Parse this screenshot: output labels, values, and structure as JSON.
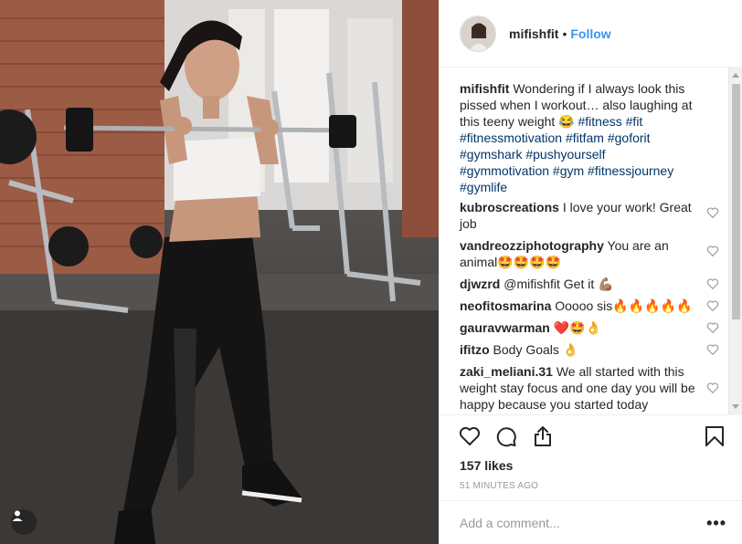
{
  "post": {
    "username": "mifishfit",
    "follow_label": "Follow",
    "caption_text": "Wondering if I always look this pissed when I workout… also laughing at this teeny weight 😂",
    "hashtags": "#fitness #fit #fitnessmotivation #fitfam #goforit #gymshark #pushyourself #gymmotivation #gym #fitnessjourney #gymlife"
  },
  "comments": [
    {
      "user": "kubroscreations",
      "text": "I love your work! Great job"
    },
    {
      "user": "vandreozziphotography",
      "text": "You are an animal🤩🤩🤩🤩"
    },
    {
      "user": "djwzrd",
      "text": "@mifishfit Get it 💪🏽"
    },
    {
      "user": "neofitosmarina",
      "text": "Ooooo sis🔥🔥🔥🔥🔥"
    },
    {
      "user": "gauravwarman",
      "text": "❤️🤩👌"
    },
    {
      "user": "ifitzo",
      "text": "Body Goals 👌"
    },
    {
      "user": "zaki_meliani.31",
      "text": "We all started with this weight stay focus and one day you will be happy because you started today"
    }
  ],
  "engagement": {
    "likes": "157 likes",
    "time": "51 MINUTES AGO"
  },
  "composer": {
    "placeholder": "Add a comment...",
    "more_label": "•••"
  },
  "icons": {
    "like": "heart-icon",
    "comment": "comment-bubble-icon",
    "share": "share-icon",
    "save": "bookmark-icon",
    "tag": "user-tag-icon"
  },
  "colors": {
    "link_blue": "#3897f0",
    "hashtag": "#003569",
    "muted": "#999999"
  }
}
